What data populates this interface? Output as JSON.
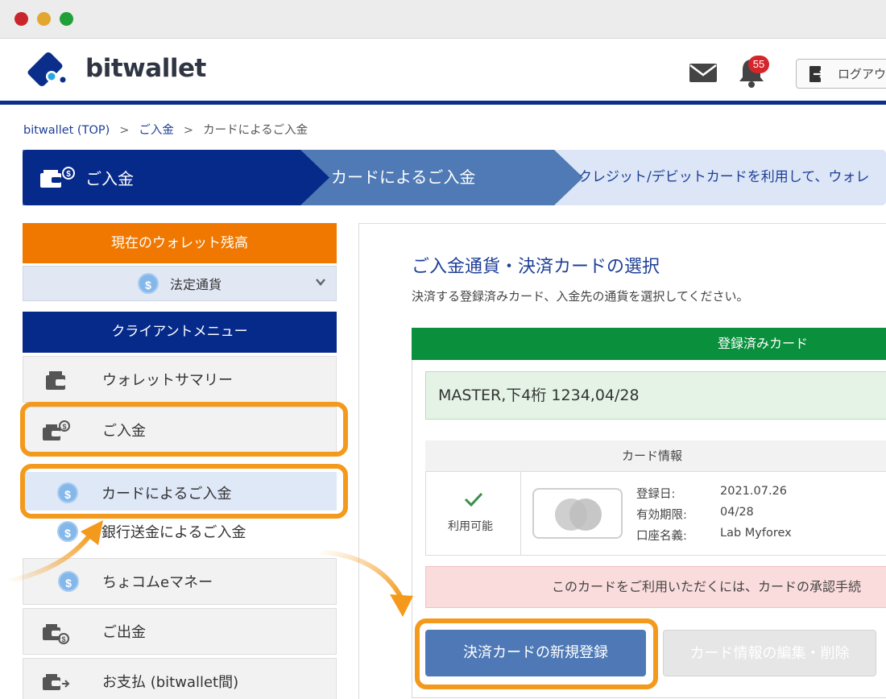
{
  "brand": {
    "name": "bitwallet"
  },
  "header": {
    "notification_count": "55",
    "logout_label": "ログアウト"
  },
  "breadcrumb": {
    "items": [
      "bitwallet (TOP)",
      "ご入金",
      "カードによるご入金"
    ],
    "separator": ">"
  },
  "banner": {
    "step1": "ご入金",
    "step2": "カードによるご入金",
    "step3": "クレジット/デビットカードを利用して、ウォレ"
  },
  "sidebar": {
    "balance_title": "現在のウォレット残高",
    "fiat_label": "法定通貨",
    "menu_title": "クライアントメニュー",
    "items": [
      {
        "label": "ウォレットサマリー",
        "icon": "wallet-icon"
      },
      {
        "label": "ご入金",
        "icon": "deposit-icon"
      },
      {
        "label": "カードによるご入金",
        "icon": "coin-icon"
      },
      {
        "label": "銀行送金によるご入金",
        "icon": "coin-icon"
      },
      {
        "label": "ちょコムeマネー",
        "icon": "coin-icon"
      },
      {
        "label": "ご出金",
        "icon": "withdraw-icon"
      },
      {
        "label": "お支払 (bitwallet間)",
        "icon": "payment-icon"
      }
    ],
    "coin_symbol": "$"
  },
  "main": {
    "title": "ご入金通貨・決済カードの選択",
    "subtitle": "決済する登録済みカード、入金先の通貨を選択してください。",
    "cards_header": "登録済みカード",
    "selected_card": "MASTER,下4桁 1234,04/28",
    "card_info": {
      "head": "カード情報",
      "status": "利用可能",
      "rows": [
        {
          "label": "登録日:",
          "value": "2021.07.26"
        },
        {
          "label": "有効期限:",
          "value": "04/28"
        },
        {
          "label": "口座名義:",
          "value": "Lab Myforex"
        }
      ]
    },
    "warning": "このカードをご利用いただくには、カードの承認手続",
    "new_card_button": "決済カードの新規登録",
    "edit_card_button": "カード情報の編集・削除"
  },
  "colors": {
    "accent_navy": "#062a8a",
    "orange": "#f07800",
    "highlight": "#f39a1d",
    "green_header": "#0a8f3d",
    "button_blue": "#4e79b6"
  }
}
